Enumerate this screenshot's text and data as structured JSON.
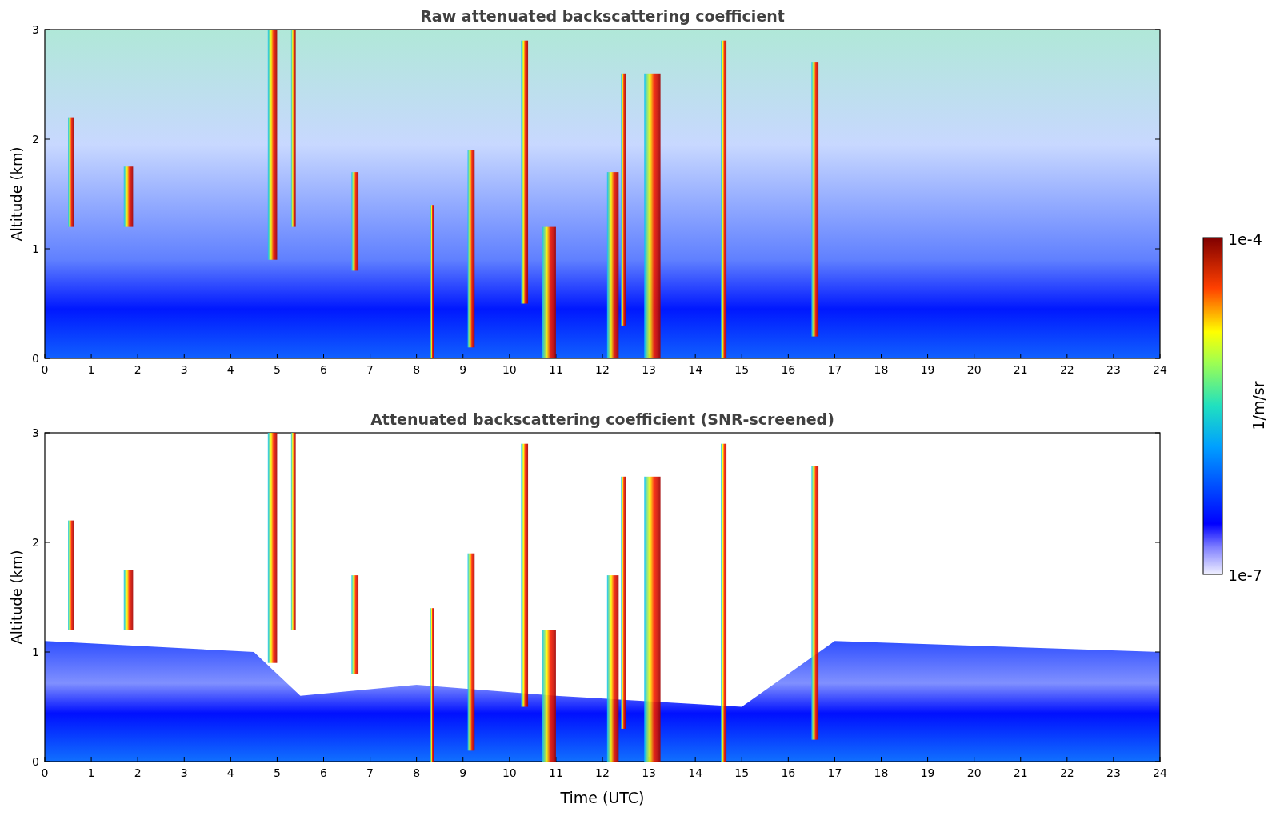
{
  "figure": {
    "panels": [
      {
        "title": "Raw attenuated backscattering coefficient",
        "ylabel": "Altitude (km)",
        "kind": "raw",
        "yticks": [
          "3",
          "2",
          "1",
          "0"
        ],
        "xticks": [
          "0",
          "1",
          "2",
          "3",
          "4",
          "5",
          "6",
          "7",
          "8",
          "9",
          "10",
          "11",
          "12",
          "13",
          "14",
          "15",
          "16",
          "17",
          "18",
          "19",
          "20",
          "21",
          "22",
          "23",
          "24"
        ]
      },
      {
        "title": "Attenuated backscattering coefficient (SNR-screened)",
        "ylabel": "Altitude (km)",
        "xlabel": "Time (UTC)",
        "kind": "screened",
        "yticks": [
          "3",
          "2",
          "1",
          "0"
        ],
        "xticks": [
          "0",
          "1",
          "2",
          "3",
          "4",
          "5",
          "6",
          "7",
          "8",
          "9",
          "10",
          "11",
          "12",
          "13",
          "14",
          "15",
          "16",
          "17",
          "18",
          "19",
          "20",
          "21",
          "22",
          "23",
          "24"
        ]
      }
    ],
    "colorbar": {
      "label": "1/m/sr",
      "max_label": "1e-4",
      "min_label": "1e-7"
    }
  }
}
